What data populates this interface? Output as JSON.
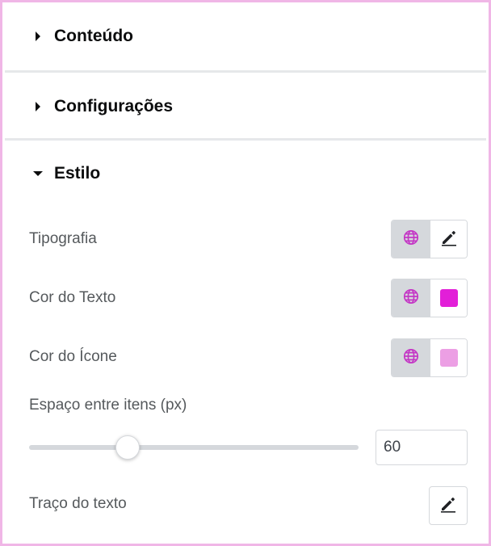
{
  "sections": {
    "content": {
      "title": "Conteúdo",
      "expanded": false
    },
    "settings": {
      "title": "Configurações",
      "expanded": false
    },
    "style": {
      "title": "Estilo",
      "expanded": true
    }
  },
  "style": {
    "typography": {
      "label": "Tipografia"
    },
    "text_color": {
      "label": "Cor do Texto",
      "color": "#e21fd8"
    },
    "icon_color": {
      "label": "Cor do Ícone",
      "color": "#ec9fe4"
    },
    "item_spacing": {
      "label": "Espaço entre itens (px)",
      "value": "60",
      "slider_fraction": 0.3
    },
    "text_stroke": {
      "label": "Traço do texto"
    }
  },
  "colors": {
    "accent": "#c436c5",
    "frame_border": "#f0b6e6"
  }
}
